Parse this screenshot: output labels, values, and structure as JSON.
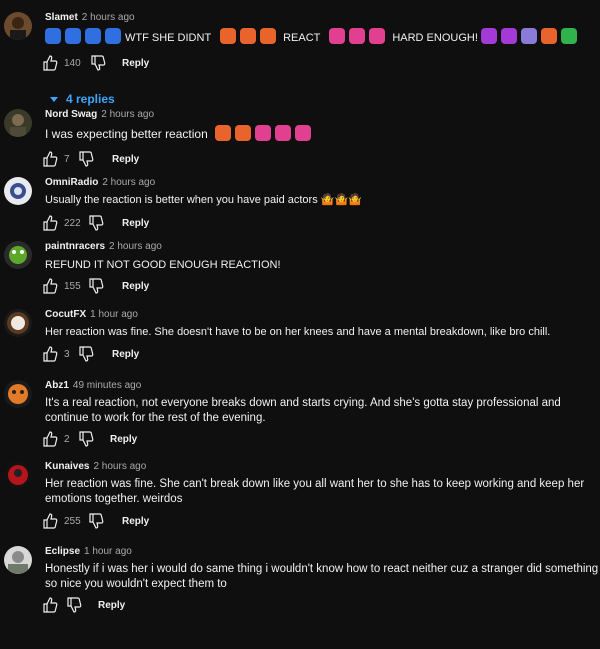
{
  "colors": {
    "background": "#0f0f0f",
    "text": "#f1f1f1",
    "meta": "#aaaaaa",
    "link": "#3ea6ff"
  },
  "comments": [
    {
      "author": "Slamet",
      "time": "2 hours ago",
      "text": "WTF SHE DIDNT",
      "text2": "REACT",
      "text3": "HARD ENOUGH!",
      "likes": "140",
      "reply": "Reply",
      "replies": "4 replies"
    },
    {
      "author": "Nord Swag",
      "time": "2 hours ago",
      "text": "I was expecting better reaction",
      "likes": "7",
      "reply": "Reply"
    },
    {
      "author": "OmniRadio",
      "time": "2 hours ago",
      "text": "Usually the reaction is better when you have paid actors 🤷🤷🤷",
      "likes": "222",
      "reply": "Reply"
    },
    {
      "author": "paintnracers",
      "time": "2 hours ago",
      "text": "REFUND IT NOT GOOD ENOUGH REACTION!",
      "likes": "155",
      "reply": "Reply"
    },
    {
      "author": "CocutFX",
      "time": "1 hour ago",
      "text": "Her reaction was fine. She doesn't have to be on her knees and have a mental breakdown, like bro chill.",
      "likes": "3",
      "reply": "Reply"
    },
    {
      "author": "Abz1",
      "time": "49 minutes ago",
      "text": "It's a real reaction, not everyone breaks down and starts crying. And she's gotta stay professional and continue to work for the rest of the evening.",
      "likes": "2",
      "reply": "Reply"
    },
    {
      "author": "Kunaives",
      "time": "2 hours ago",
      "text": "Her reaction was fine. She can't break down like you all want her to she has to keep working and keep her emotions together. weirdos",
      "likes": "255",
      "reply": "Reply"
    },
    {
      "author": "Eclipse",
      "time": "1 hour ago",
      "text": "Honestly if i was her i would do same thing i wouldn't know how to react neither cuz a stranger did something so nice you wouldn't expect them to",
      "likes": "",
      "reply": "Reply"
    }
  ]
}
